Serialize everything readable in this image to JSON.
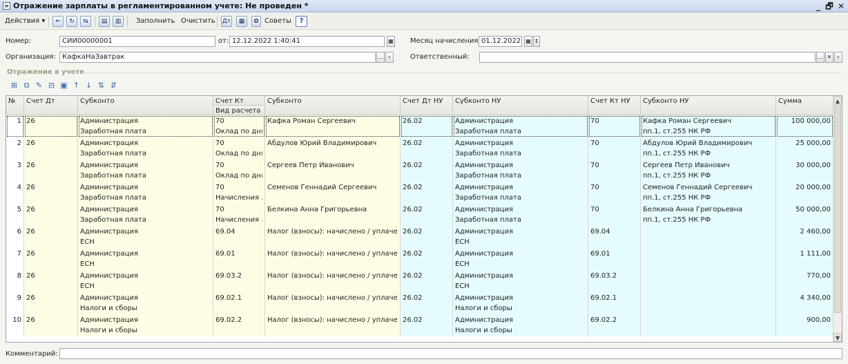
{
  "window": {
    "title": "Отражение зарплаты в регламентированном учете: Не проведен *",
    "min": "_",
    "restore": "🗗",
    "close": "✕"
  },
  "toolbar": {
    "actions": "Действия ▾",
    "fill": "Заполнить",
    "clear": "Очистить",
    "tips": "Советы",
    "help": "?"
  },
  "form": {
    "number_label": "Номер:",
    "number": "СИИ00000001",
    "from_label": "от:",
    "date": "12.12.2022 1:40:41",
    "month_label": "Месяц начисления:",
    "month": "01.12.2022",
    "org_label": "Организация:",
    "org": "КафкаНаЗавтрак",
    "resp_label": "Ответственный:",
    "resp": "",
    "section": "Отражение в учете",
    "comment_label": "Комментарий:",
    "comment": ""
  },
  "grid": {
    "headers": {
      "n": "№",
      "dt": "Счет Дт",
      "sub": "Субконто",
      "kt": "Счет Кт",
      "kt2": "Вид расчета",
      "sub2": "Субконто",
      "dtnu": "Счет Дт НУ",
      "subnu": "Субконто НУ",
      "ktnu": "Счет Кт НУ",
      "subnu2": "Субконто НУ",
      "sum": "Сумма"
    },
    "rows": [
      {
        "n": "1",
        "dt": "26",
        "s1": "Администрация",
        "s1b": "Заработная плата",
        "kt": "70",
        "kt2": "Оклад по дням",
        "s2": "Кафка Роман Сергеевич",
        "dtnu": "26.02",
        "nu1": "Администрация",
        "nu1b": "Заработная плата",
        "ktnu": "70",
        "nu2": "Кафка Роман Сергеевич",
        "nu2b": "пп.1, ст.255 НК РФ",
        "sum": "100 000,00"
      },
      {
        "n": "2",
        "dt": "26",
        "s1": "Администрация",
        "s1b": "Заработная плата",
        "kt": "70",
        "kt2": "Оклад по дням",
        "s2": "Абдулов Юрий Владимирович",
        "dtnu": "26.02",
        "nu1": "Администрация",
        "nu1b": "Заработная плата",
        "ktnu": "70",
        "nu2": "Абдулов Юрий Владимирович",
        "nu2b": "пп.1, ст.255 НК РФ",
        "sum": "25 000,00"
      },
      {
        "n": "3",
        "dt": "26",
        "s1": "Администрация",
        "s1b": "Заработная плата",
        "kt": "70",
        "kt2": "Оклад по дням",
        "s2": "Сергеев Петр Иванович",
        "dtnu": "26.02",
        "nu1": "Администрация",
        "nu1b": "Заработная плата",
        "ktnu": "70",
        "nu2": "Сергеев Петр Иванович",
        "nu2b": "пп.1, ст.255 НК РФ",
        "sum": "30 000,00"
      },
      {
        "n": "4",
        "dt": "26",
        "s1": "Администрация",
        "s1b": "Заработная плата",
        "kt": "70",
        "kt2": "Начисления ...",
        "s2": "Семенов Геннадий Сергеевич",
        "dtnu": "26.02",
        "nu1": "Администрация",
        "nu1b": "Заработная плата",
        "ktnu": "70",
        "nu2": "Семенов Геннадий Сергеевич",
        "nu2b": "пп.1, ст.255 НК РФ",
        "sum": "20 000,00"
      },
      {
        "n": "5",
        "dt": "26",
        "s1": "Администрация",
        "s1b": "Заработная плата",
        "kt": "70",
        "kt2": "Начисления ...",
        "s2": "Белкина Анна Григорьевна",
        "dtnu": "26.02",
        "nu1": "Администрация",
        "nu1b": "Заработная плата",
        "ktnu": "70",
        "nu2": "Белкина Анна Григорьевна",
        "nu2b": "пп.1, ст.255 НК РФ",
        "sum": "50 000,00"
      },
      {
        "n": "6",
        "dt": "26",
        "s1": "Администрация",
        "s1b": "ЕСН",
        "kt": "69.04",
        "kt2": "",
        "s2": "Налог (взносы): начислено / уплачено",
        "dtnu": "26.02",
        "nu1": "Администрация",
        "nu1b": "ЕСН",
        "ktnu": "69.04",
        "nu2": "",
        "nu2b": "",
        "sum": "2 460,00"
      },
      {
        "n": "7",
        "dt": "26",
        "s1": "Администрация",
        "s1b": "ЕСН",
        "kt": "69.01",
        "kt2": "",
        "s2": "Налог (взносы): начислено / уплачено",
        "dtnu": "26.02",
        "nu1": "Администрация",
        "nu1b": "ЕСН",
        "ktnu": "69.01",
        "nu2": "",
        "nu2b": "",
        "sum": "1 111,00"
      },
      {
        "n": "8",
        "dt": "26",
        "s1": "Администрация",
        "s1b": "ЕСН",
        "kt": "69.03.2",
        "kt2": "",
        "s2": "Налог (взносы): начислено / уплачено",
        "dtnu": "26.02",
        "nu1": "Администрация",
        "nu1b": "ЕСН",
        "ktnu": "69.03.2",
        "nu2": "",
        "nu2b": "",
        "sum": "770,00"
      },
      {
        "n": "9",
        "dt": "26",
        "s1": "Администрация",
        "s1b": "Налоги и сборы",
        "kt": "69.02.1",
        "kt2": "",
        "s2": "Налог (взносы): начислено / уплачено",
        "dtnu": "26.02",
        "nu1": "Администрация",
        "nu1b": "Налоги и сборы",
        "ktnu": "69.02.1",
        "nu2": "",
        "nu2b": "",
        "sum": "4 340,00"
      },
      {
        "n": "10",
        "dt": "26",
        "s1": "Администрация",
        "s1b": "Налоги и сборы",
        "kt": "69.02.2",
        "kt2": "",
        "s2": "Налог (взносы): начислено / уплачено",
        "dtnu": "26.02",
        "nu1": "Администрация",
        "nu1b": "Налоги и сборы",
        "ktnu": "69.02.2",
        "nu2": "",
        "nu2b": "",
        "sum": "900,00"
      }
    ]
  }
}
